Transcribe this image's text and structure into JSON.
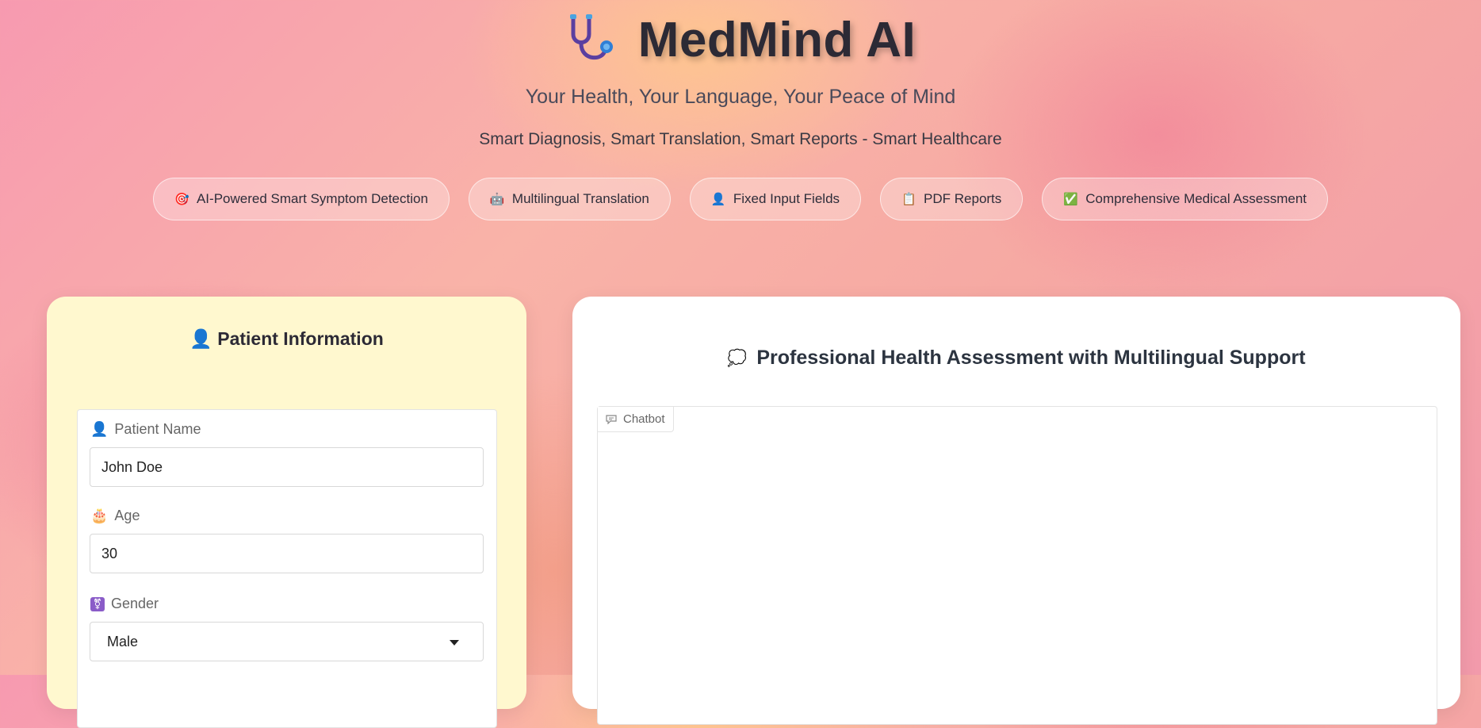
{
  "app": {
    "title": "MedMind AI",
    "tagline": "Your Health, Your Language, Your Peace of Mind",
    "subtagline": "Smart Diagnosis, Smart Translation, Smart Reports - Smart Healthcare"
  },
  "features": [
    {
      "icon": "target-icon",
      "glyph": "🎯",
      "label": "AI-Powered Smart Symptom Detection"
    },
    {
      "icon": "robot-icon",
      "glyph": "🤖",
      "label": "Multilingual Translation"
    },
    {
      "icon": "person-icon",
      "glyph": "👤",
      "label": "Fixed Input Fields"
    },
    {
      "icon": "document-icon",
      "glyph": "📋",
      "label": "PDF Reports"
    },
    {
      "icon": "checkmark-icon",
      "glyph": "✅",
      "label": "Comprehensive Medical Assessment"
    }
  ],
  "patient_panel": {
    "heading": "Patient Information",
    "fields": {
      "name": {
        "label": "Patient Name",
        "value": "John Doe"
      },
      "age": {
        "label": "Age",
        "value": "30"
      },
      "gender": {
        "label": "Gender",
        "value": "Male"
      }
    }
  },
  "chat_panel": {
    "heading": "Professional Health Assessment with Multilingual Support",
    "tab_label": "Chatbot"
  },
  "colors": {
    "accent": "#2c2a35",
    "left_panel_bg": "#fff8cf",
    "right_panel_bg": "#ffffff"
  }
}
